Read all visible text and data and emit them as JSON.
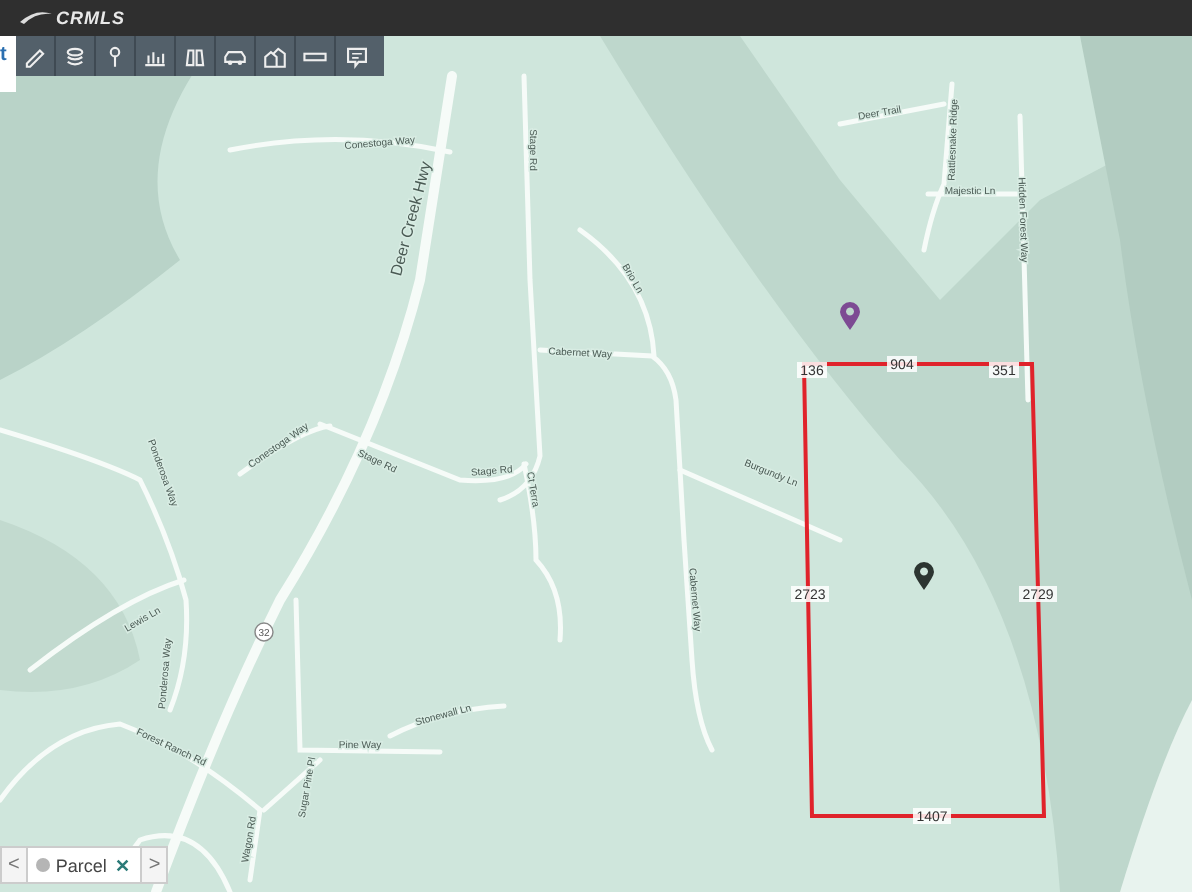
{
  "header": {
    "logo": "CRMLS"
  },
  "side_panel": {
    "label": "t"
  },
  "toolbar": {
    "tools": [
      {
        "kind": "pencil"
      },
      {
        "kind": "layers"
      },
      {
        "kind": "pin"
      },
      {
        "kind": "chart"
      },
      {
        "kind": "binoculars"
      },
      {
        "kind": "car"
      },
      {
        "kind": "houses"
      },
      {
        "kind": "ruler"
      },
      {
        "kind": "comment"
      }
    ]
  },
  "map": {
    "road_labels": [
      "Conestoga Way",
      "Deer Creek Hwy",
      "Stage Rd",
      "Brio Ln",
      "Cabernet Way",
      "Conestoga Way",
      "Stage Rd",
      "Stage Rd",
      "Ct Terra",
      "Burgundy Ln",
      "Cabernet Way",
      "Ponderosa Way",
      "Lewis Ln",
      "32",
      "Ponderosa Way",
      "Forest Ranch Rd",
      "Pine Way",
      "Stonewall Ln",
      "Sugar Pine Pl",
      "Wagon Rd",
      "Deer Trail",
      "Rattlesnake Ridge",
      "Majestic Ln",
      "Hidden Forest Way"
    ],
    "parcel_edges": [
      "136",
      "904",
      "351",
      "2723",
      "2729",
      "1407"
    ],
    "pins": [
      {
        "color": "#7d4a93"
      },
      {
        "color": "#2c3531"
      }
    ]
  },
  "layer_bar": {
    "prev": "<",
    "chip": {
      "label": "Parcel",
      "close": "✕"
    },
    "next": ">"
  }
}
